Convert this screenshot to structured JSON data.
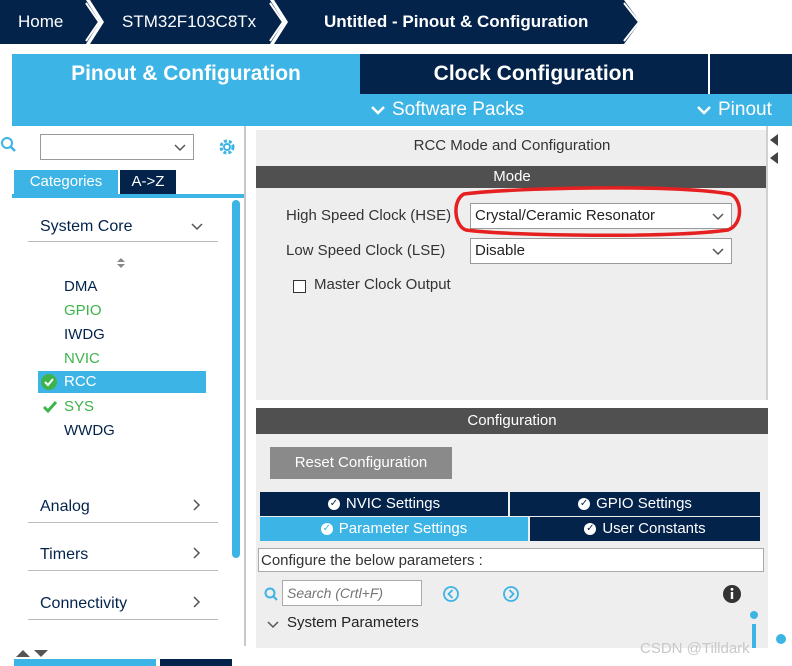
{
  "breadcrumb": {
    "home": "Home",
    "mcu": "STM32F103C8Tx",
    "project": "Untitled - Pinout & Configuration"
  },
  "tabs": {
    "pinout": "Pinout & Configuration",
    "clock": "Clock Configuration"
  },
  "subbar": {
    "software_packs": "Software Packs",
    "pinout": "Pinout"
  },
  "left": {
    "search_value": "",
    "tab_categories": "Categories",
    "tab_az": "A->Z",
    "system_core": "System Core",
    "items": [
      "DMA",
      "GPIO",
      "IWDG",
      "NVIC",
      "RCC",
      "SYS",
      "WWDG"
    ],
    "analog": "Analog",
    "timers": "Timers",
    "connectivity": "Connectivity"
  },
  "mode": {
    "panel_title": "RCC Mode and Configuration",
    "mode_header": "Mode",
    "hse_label": "High Speed Clock (HSE)",
    "hse_value": "Crystal/Ceramic Resonator",
    "lse_label": "Low Speed Clock (LSE)",
    "lse_value": "Disable",
    "mco_label": "Master Clock Output"
  },
  "config": {
    "header": "Configuration",
    "reset_button": "Reset Configuration",
    "tabs": [
      "NVIC Settings",
      "GPIO Settings",
      "Parameter Settings",
      "User Constants"
    ],
    "configure_text": "Configure the below parameters :",
    "search_placeholder": "Search (Crtl+F)",
    "system_parameters": "System Parameters"
  },
  "watermark": "CSDN @Tilldark",
  "colors": {
    "navy": "#03234b",
    "blue": "#3cb4e6",
    "dark_bar": "#505050",
    "green": "#3cb44b",
    "highlight": "#e62020"
  }
}
